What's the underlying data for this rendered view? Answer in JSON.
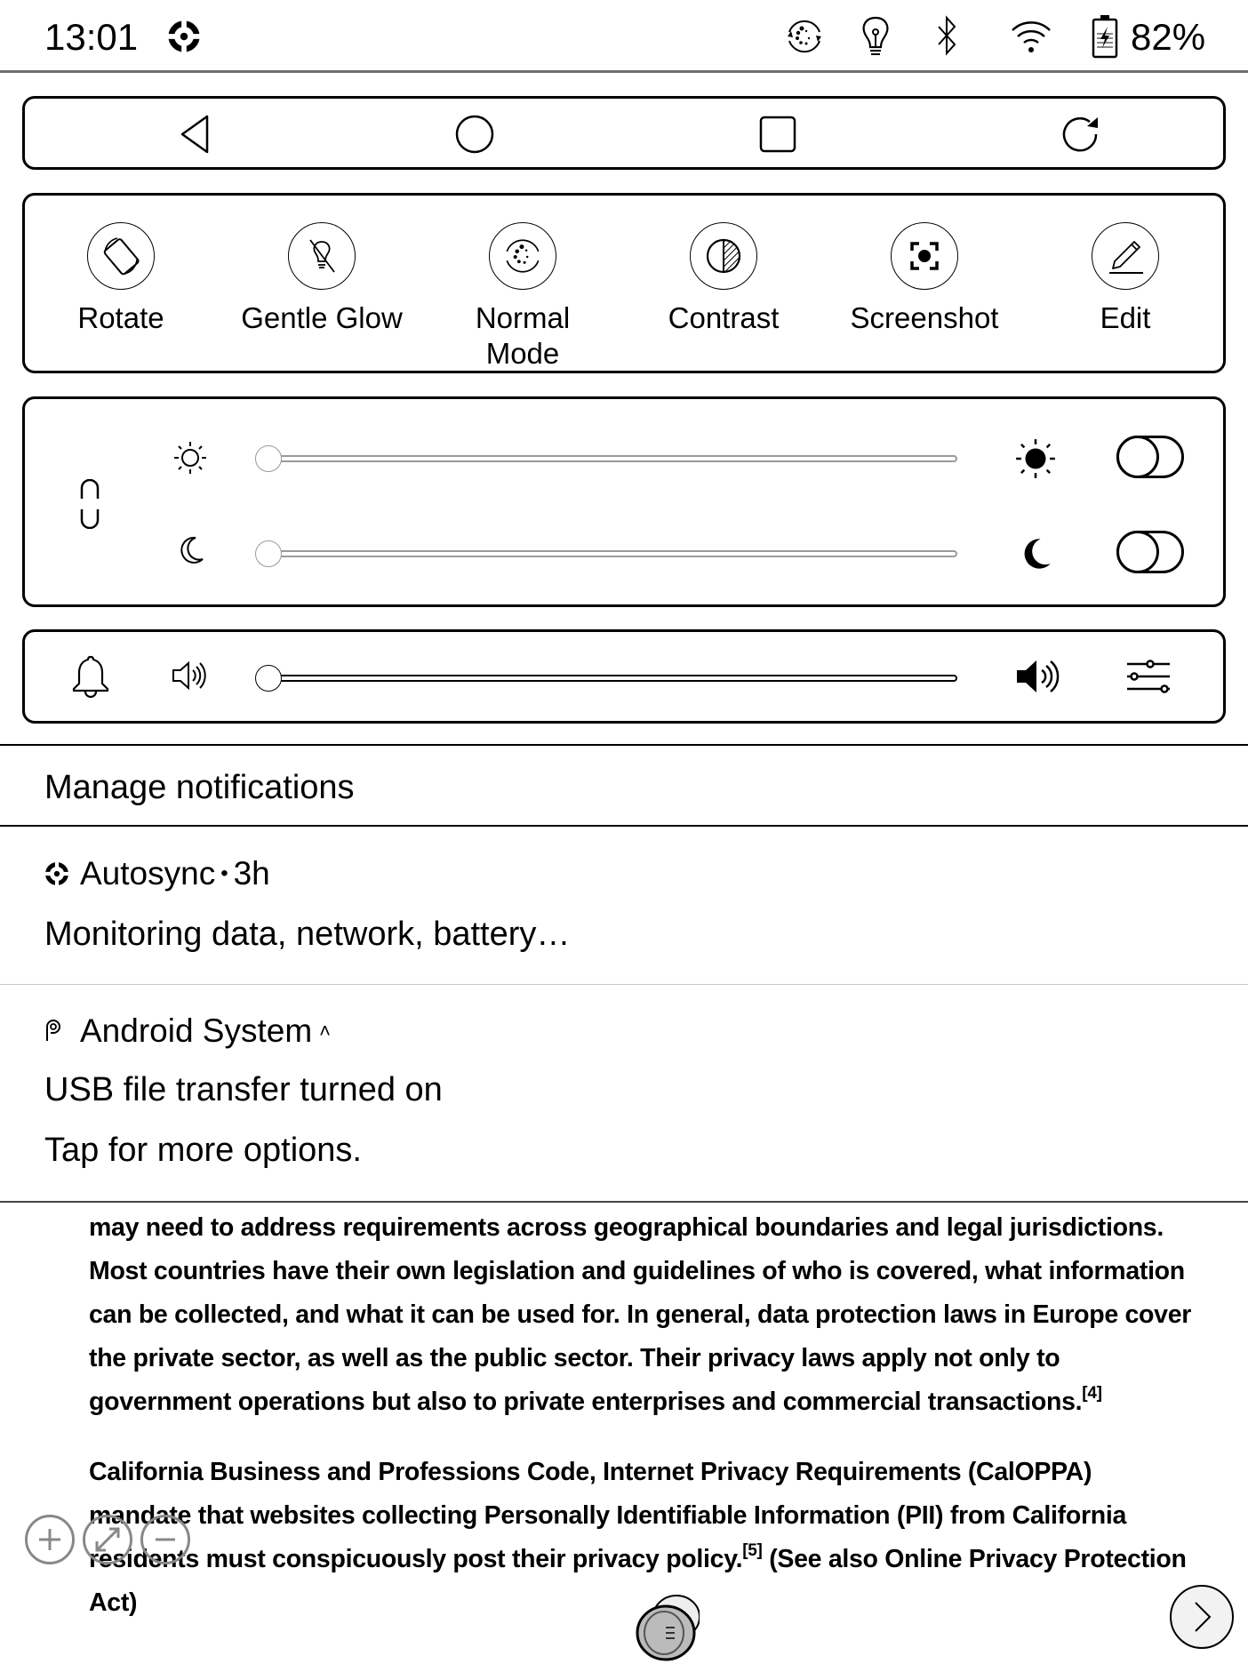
{
  "status_bar": {
    "time": "13:01",
    "left_icons": [
      "autosync-icon"
    ],
    "right_icons": [
      "refresh-mode-icon",
      "frontlight-icon",
      "bluetooth-icon",
      "wifi-icon",
      "battery-charging-icon"
    ],
    "battery_percent": "82%"
  },
  "nav_bar": {
    "buttons": [
      {
        "name": "back",
        "icon": "back-triangle-icon"
      },
      {
        "name": "home",
        "icon": "home-circle-icon"
      },
      {
        "name": "recents",
        "icon": "recents-square-icon"
      },
      {
        "name": "refresh",
        "icon": "refresh-icon"
      }
    ]
  },
  "quick_settings": {
    "items": [
      {
        "label": "Rotate",
        "icon": "rotate-icon"
      },
      {
        "label": "Gentle Glow",
        "icon": "bulb-off-icon"
      },
      {
        "label": "Normal Mode",
        "icon": "refresh-mode-icon"
      },
      {
        "label": "Contrast",
        "icon": "contrast-icon"
      },
      {
        "label": "Screenshot",
        "icon": "screenshot-icon"
      },
      {
        "label": "Edit",
        "icon": "pencil-icon"
      }
    ]
  },
  "frontlight": {
    "link_icon": "link-icon",
    "warm_light": {
      "low_icon": "sun-outline-icon",
      "high_icon": "sun-filled-icon",
      "value_percent": 0,
      "enabled": false
    },
    "cold_light": {
      "low_icon": "moon-outline-icon",
      "high_icon": "moon-filled-icon",
      "value_percent": 0,
      "enabled": false
    }
  },
  "volume": {
    "bell_icon": "bell-icon",
    "low_icon": "volume-low-icon",
    "high_icon": "volume-high-icon",
    "settings_icon": "sliders-icon",
    "value_percent": 0
  },
  "notifications": {
    "manage_label": "Manage notifications",
    "items": [
      {
        "app": "Autosync",
        "time": "3h",
        "separator": "•",
        "text": "Monitoring data, network, battery…",
        "icon": "autosync-icon"
      },
      {
        "app": "Android System",
        "expand": "˄",
        "title": "USB file transfer turned on",
        "text": "Tap for more options.",
        "icon": "android-p-icon"
      }
    ]
  },
  "reader": {
    "paragraphs": [
      {
        "text": "may need to address requirements across geographical boundaries and legal jurisdictions. Most countries have their own legislation and guidelines of who is covered, what information can be collected, and what it can be used for. In general, data protection laws in Europe cover the private sector, as well as the public sector. Their privacy laws apply not only to government operations but also to private enterprises and commercial transactions.",
        "ref": "[4]",
        "after": ""
      },
      {
        "text": "California Business and Professions Code, Internet Privacy Requirements (CalOPPA) mandate that websites collecting Personally Identifiable Information (PII) from California residents must conspicuously post their privacy policy.",
        "ref": "[5]",
        "after": " (See also Online Privacy Protection Act)"
      }
    ],
    "zoom_controls": [
      "zoom-in",
      "fit-screen",
      "zoom-out"
    ],
    "next_page_icon": "chevron-right-icon"
  }
}
